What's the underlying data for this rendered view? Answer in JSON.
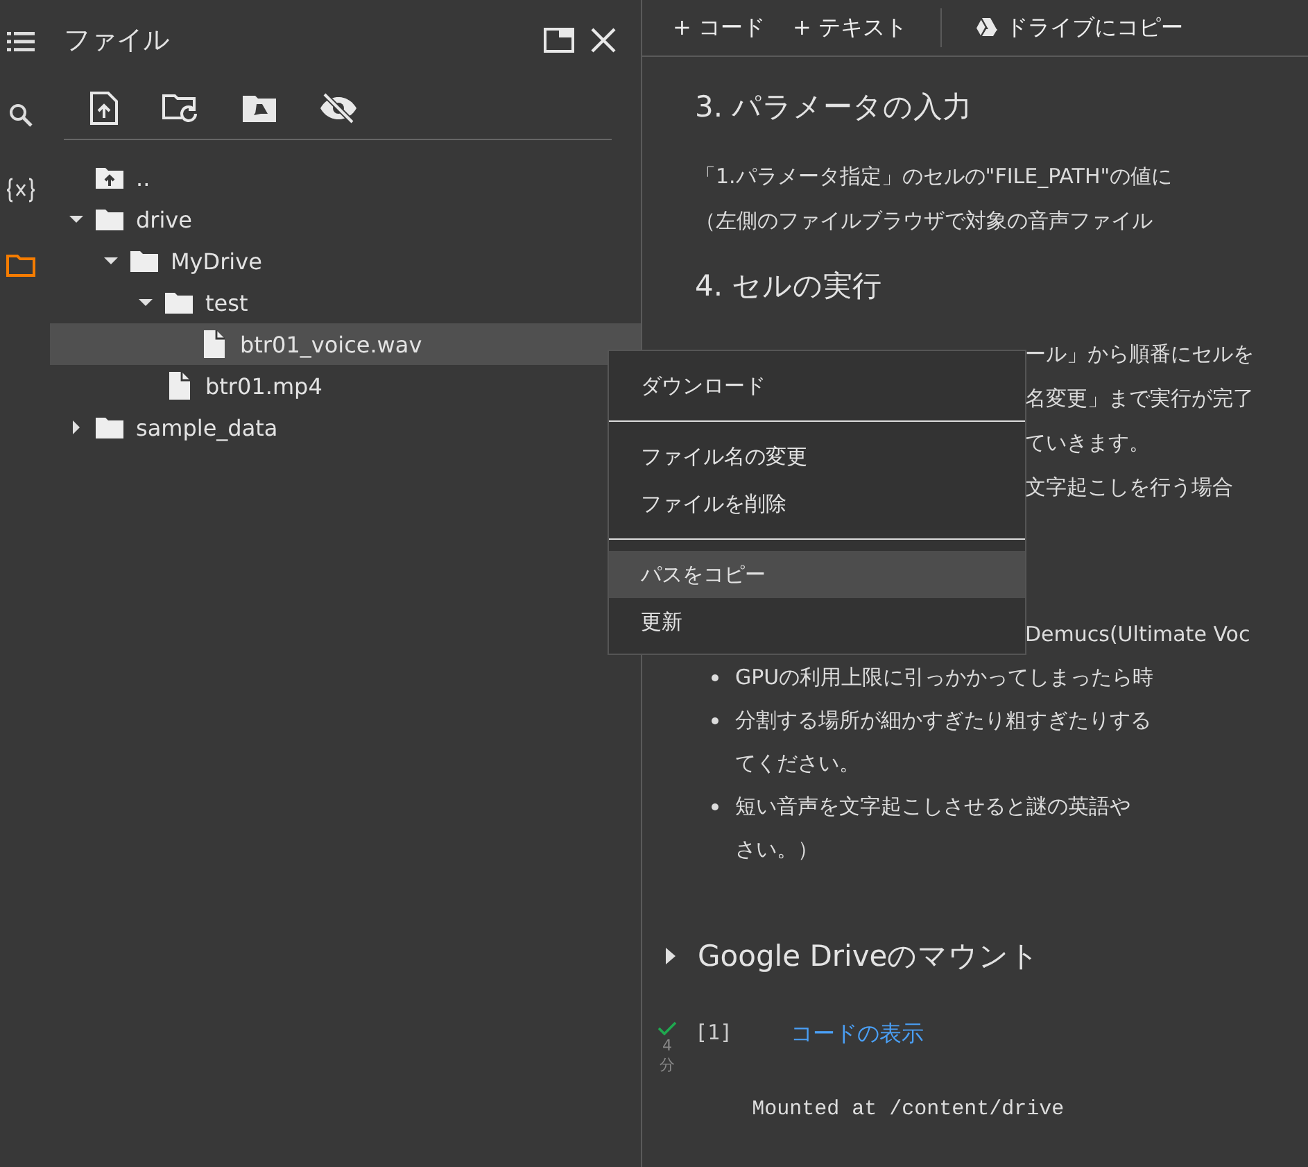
{
  "activity_bar": [
    {
      "kind": "toc",
      "selected": false
    },
    {
      "kind": "search",
      "selected": false
    },
    {
      "kind": "variables",
      "selected": false
    },
    {
      "kind": "files",
      "selected": true
    }
  ],
  "file_panel": {
    "title": "ファイル",
    "toolbar": [
      {
        "kind": "upload"
      },
      {
        "kind": "refresh"
      },
      {
        "kind": "drive"
      },
      {
        "kind": "hide"
      }
    ],
    "tree": [
      {
        "kind": "parent",
        "name": "..",
        "selected": false
      },
      {
        "kind": "folder",
        "name": "drive",
        "expanded": true,
        "selected": false,
        "children": [
          {
            "kind": "folder",
            "name": "MyDrive",
            "expanded": true,
            "selected": false,
            "children": [
              {
                "kind": "folder",
                "name": "test",
                "expanded": true,
                "selected": false,
                "children": [
                  {
                    "kind": "file",
                    "name": "btr01_voice.wav",
                    "selected": true
                  }
                ]
              },
              {
                "kind": "file",
                "name": "btr01.mp4",
                "selected": false
              }
            ]
          }
        ]
      },
      {
        "kind": "folder",
        "name": "sample_data",
        "expanded": false,
        "selected": false
      }
    ]
  },
  "context_menu": {
    "groups": [
      [
        {
          "label": "ダウンロード",
          "selected": false
        }
      ],
      [
        {
          "label": "ファイル名の変更",
          "selected": false
        },
        {
          "label": "ファイルを削除",
          "selected": false
        }
      ],
      [
        {
          "label": "パスをコピー",
          "selected": true
        },
        {
          "label": "更新",
          "selected": false
        }
      ]
    ]
  },
  "toolbar": {
    "add_code": "+ コード",
    "add_text": "+ テキスト",
    "copy_to_drive": "ドライブにコピー"
  },
  "notebook": {
    "heading_3": "3. パラメータの入力",
    "para_3": [
      "「1.パラメータ指定」のセルの\"FILE_PATH\"の値に",
      "（左側のファイルブラウザで対象の音声ファイル"
    ],
    "heading_4": "4. セルの実行",
    "fragments": [
      "ール」から順番にセルを",
      "名変更」まで実行が完了",
      "ていきます。",
      "文字起こしを行う場合",
      "Demucs(Ultimate Voc"
    ],
    "bullets": [
      [
        "GPUの利用上限に引っかかってしまったら時"
      ],
      [
        "分割する場所が細かすぎたり粗すぎたりする",
        "てください。"
      ],
      [
        "短い音声を文字起こしさせると謎の英語や",
        "さい。）"
      ]
    ],
    "section": {
      "title": "Google Driveのマウント",
      "expanded": false
    },
    "cell": {
      "completed": true,
      "count": "[1]",
      "time": [
        "4",
        "分"
      ],
      "show_code": "コードの表示",
      "output": "Mounted at /content/drive"
    }
  }
}
